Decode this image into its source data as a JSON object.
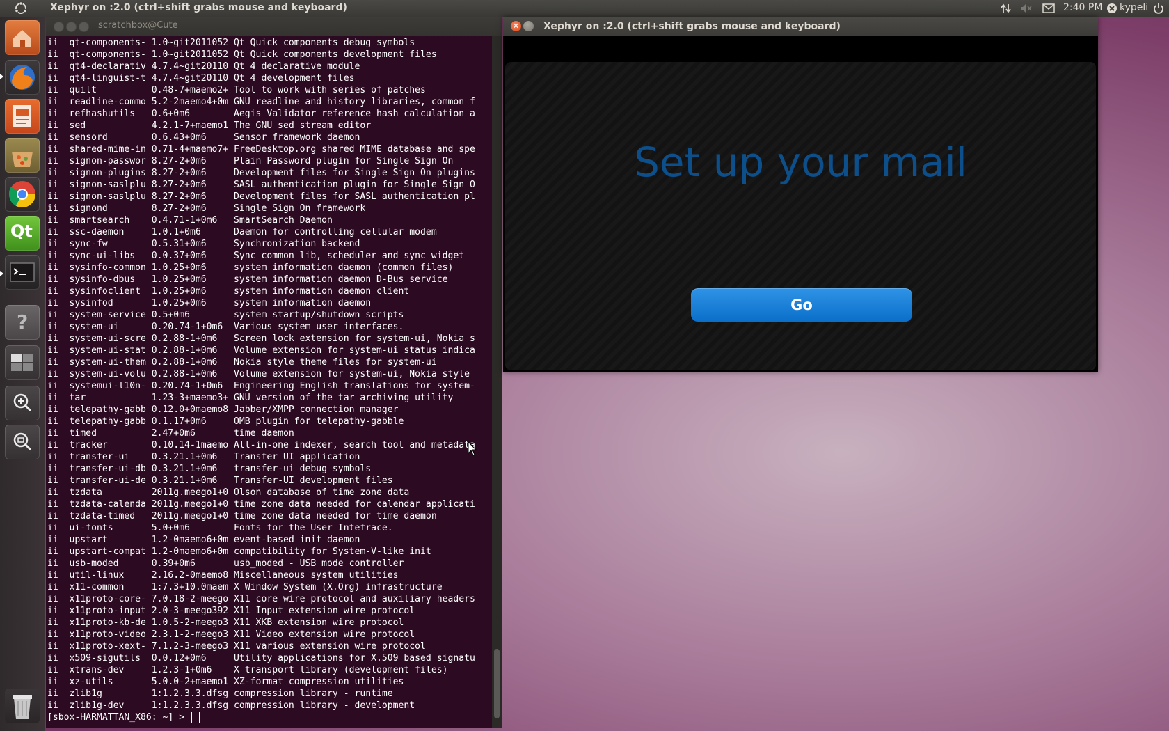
{
  "top_panel": {
    "title": "Xephyr on :2.0 (ctrl+shift grabs mouse and keyboard)",
    "clock": "2:40 PM",
    "user": "kypeli",
    "icons": [
      "ubuntu-logo-icon",
      "network-icon",
      "volume-muted-icon",
      "mail-icon",
      "user-x-icon",
      "power-icon"
    ]
  },
  "launcher": {
    "items": [
      "home-folder-icon",
      "firefox-icon",
      "libreoffice-impress-icon",
      "software-center-icon",
      "chrome-icon",
      "qt-creator-icon",
      "terminal-icon",
      "help-icon",
      "workspace-switcher-icon",
      "magnifier-zoom-icon",
      "magnifier-zoom-out-icon",
      "trash-icon"
    ],
    "qt_label": "Qt"
  },
  "terminal": {
    "title": "scratchbox@Cute",
    "lines": [
      "ii  qt-components- 1.0~git2011052 Qt Quick components debug symbols",
      "ii  qt-components- 1.0~git2011052 Qt Quick components development files",
      "ii  qt4-declarativ 4.7.4~git20110 Qt 4 declarative module",
      "ii  qt4-linguist-t 4.7.4~git20110 Qt 4 development files",
      "ii  quilt          0.48-7+maemo2+ Tool to work with series of patches",
      "ii  readline-commo 5.2-2maemo4+0m GNU readline and history libraries, common f",
      "ii  refhashutils   0.6+0m6        Aegis Validator reference hash calculation a",
      "ii  sed            4.2.1-7+maemo1 The GNU sed stream editor",
      "ii  sensord        0.6.43+0m6     Sensor framework daemon",
      "ii  shared-mime-in 0.71-4+maemo7+ FreeDesktop.org shared MIME database and spe",
      "ii  signon-passwor 8.27-2+0m6     Plain Password plugin for Single Sign On",
      "ii  signon-plugins 8.27-2+0m6     Development files for Single Sign On plugins",
      "ii  signon-saslplu 8.27-2+0m6     SASL authentication plugin for Single Sign O",
      "ii  signon-saslplu 8.27-2+0m6     Development files for SASL authentication pl",
      "ii  signond        8.27-2+0m6     Single Sign On framework",
      "ii  smartsearch    0.4.71-1+0m6   SmartSearch Daemon",
      "ii  ssc-daemon     1.0.1+0m6      Daemon for controlling cellular modem",
      "ii  sync-fw        0.5.31+0m6     Synchronization backend",
      "ii  sync-ui-libs   0.0.37+0m6     Sync common lib, scheduler and sync widget",
      "ii  sysinfo-common 1.0.25+0m6     system information daemon (common files)",
      "ii  sysinfo-dbus   1.0.25+0m6     system information daemon D-Bus service",
      "ii  sysinfoclient  1.0.25+0m6     system information daemon client",
      "ii  sysinfod       1.0.25+0m6     system information daemon",
      "ii  system-service 0.5+0m6        system startup/shutdown scripts",
      "ii  system-ui      0.20.74-1+0m6  Various system user interfaces.",
      "ii  system-ui-scre 0.2.88-1+0m6   Screen lock extension for system-ui, Nokia s",
      "ii  system-ui-stat 0.2.88-1+0m6   Volume extension for system-ui status indica",
      "ii  system-ui-them 0.2.88-1+0m6   Nokia style theme files for system-ui",
      "ii  system-ui-volu 0.2.88-1+0m6   Volume extension for system-ui, Nokia style",
      "ii  systemui-l10n- 0.20.74-1+0m6  Engineering English translations for system-",
      "ii  tar            1.23-3+maemo3+ GNU version of the tar archiving utility",
      "ii  telepathy-gabb 0.12.0+0maemo8 Jabber/XMPP connection manager",
      "ii  telepathy-gabb 0.1.17+0m6     OMB plugin for telepathy-gabble",
      "ii  timed          2.47+0m6       time daemon",
      "ii  tracker        0.10.14-1maemo All-in-one indexer, search tool and metadata",
      "ii  transfer-ui    0.3.21.1+0m6   Transfer UI application",
      "ii  transfer-ui-db 0.3.21.1+0m6   transfer-ui debug symbols",
      "ii  transfer-ui-de 0.3.21.1+0m6   Transfer-UI development files",
      "ii  tzdata         2011g.meego1+0 Olson database of time zone data",
      "ii  tzdata-calenda 2011g.meego1+0 time zone data needed for calendar applicati",
      "ii  tzdata-timed   2011g.meego1+0 time zone data needed for time daemon",
      "ii  ui-fonts       5.0+0m6        Fonts for the User Intefrace.",
      "ii  upstart        1.2-0maemo6+0m event-based init daemon",
      "ii  upstart-compat 1.2-0maemo6+0m compatibility for System-V-like init",
      "ii  usb-moded      0.39+0m6       usb_moded - USB mode controller",
      "ii  util-linux     2.16.2-0maemo8 Miscellaneous system utilities",
      "ii  x11-common     1:7.3+10.0maem X Window System (X.Org) infrastructure",
      "ii  x11proto-core- 7.0.18-2-meego X11 core wire protocol and auxiliary headers",
      "ii  x11proto-input 2.0-3-meego392 X11 Input extension wire protocol",
      "ii  x11proto-kb-de 1.0.5-2-meego3 X11 XKB extension wire protocol",
      "ii  x11proto-video 2.3.1-2-meego3 X11 Video extension wire protocol",
      "ii  x11proto-xext- 7.1.2-3-meego3 X11 various extension wire protocol",
      "ii  x509-sigutils  0.0.12+0m6     Utility applications for X.509 based signatu",
      "ii  xtrans-dev     1.2.3-1+0m6    X transport library (development files)",
      "ii  xz-utils       5.0.0-2+maemo1 XZ-format compression utilities",
      "ii  zlib1g         1:1.2.3.3.dfsg compression library - runtime",
      "ii  zlib1g-dev     1:1.2.3.3.dfsg compression library - development"
    ],
    "prompt": "[sbox-HARMATTAN_X86: ~] > "
  },
  "xephyr": {
    "title": "Xephyr on :2.0 (ctrl+shift grabs mouse and keyboard)",
    "heading": "Set up your mail",
    "go_label": "Go"
  }
}
